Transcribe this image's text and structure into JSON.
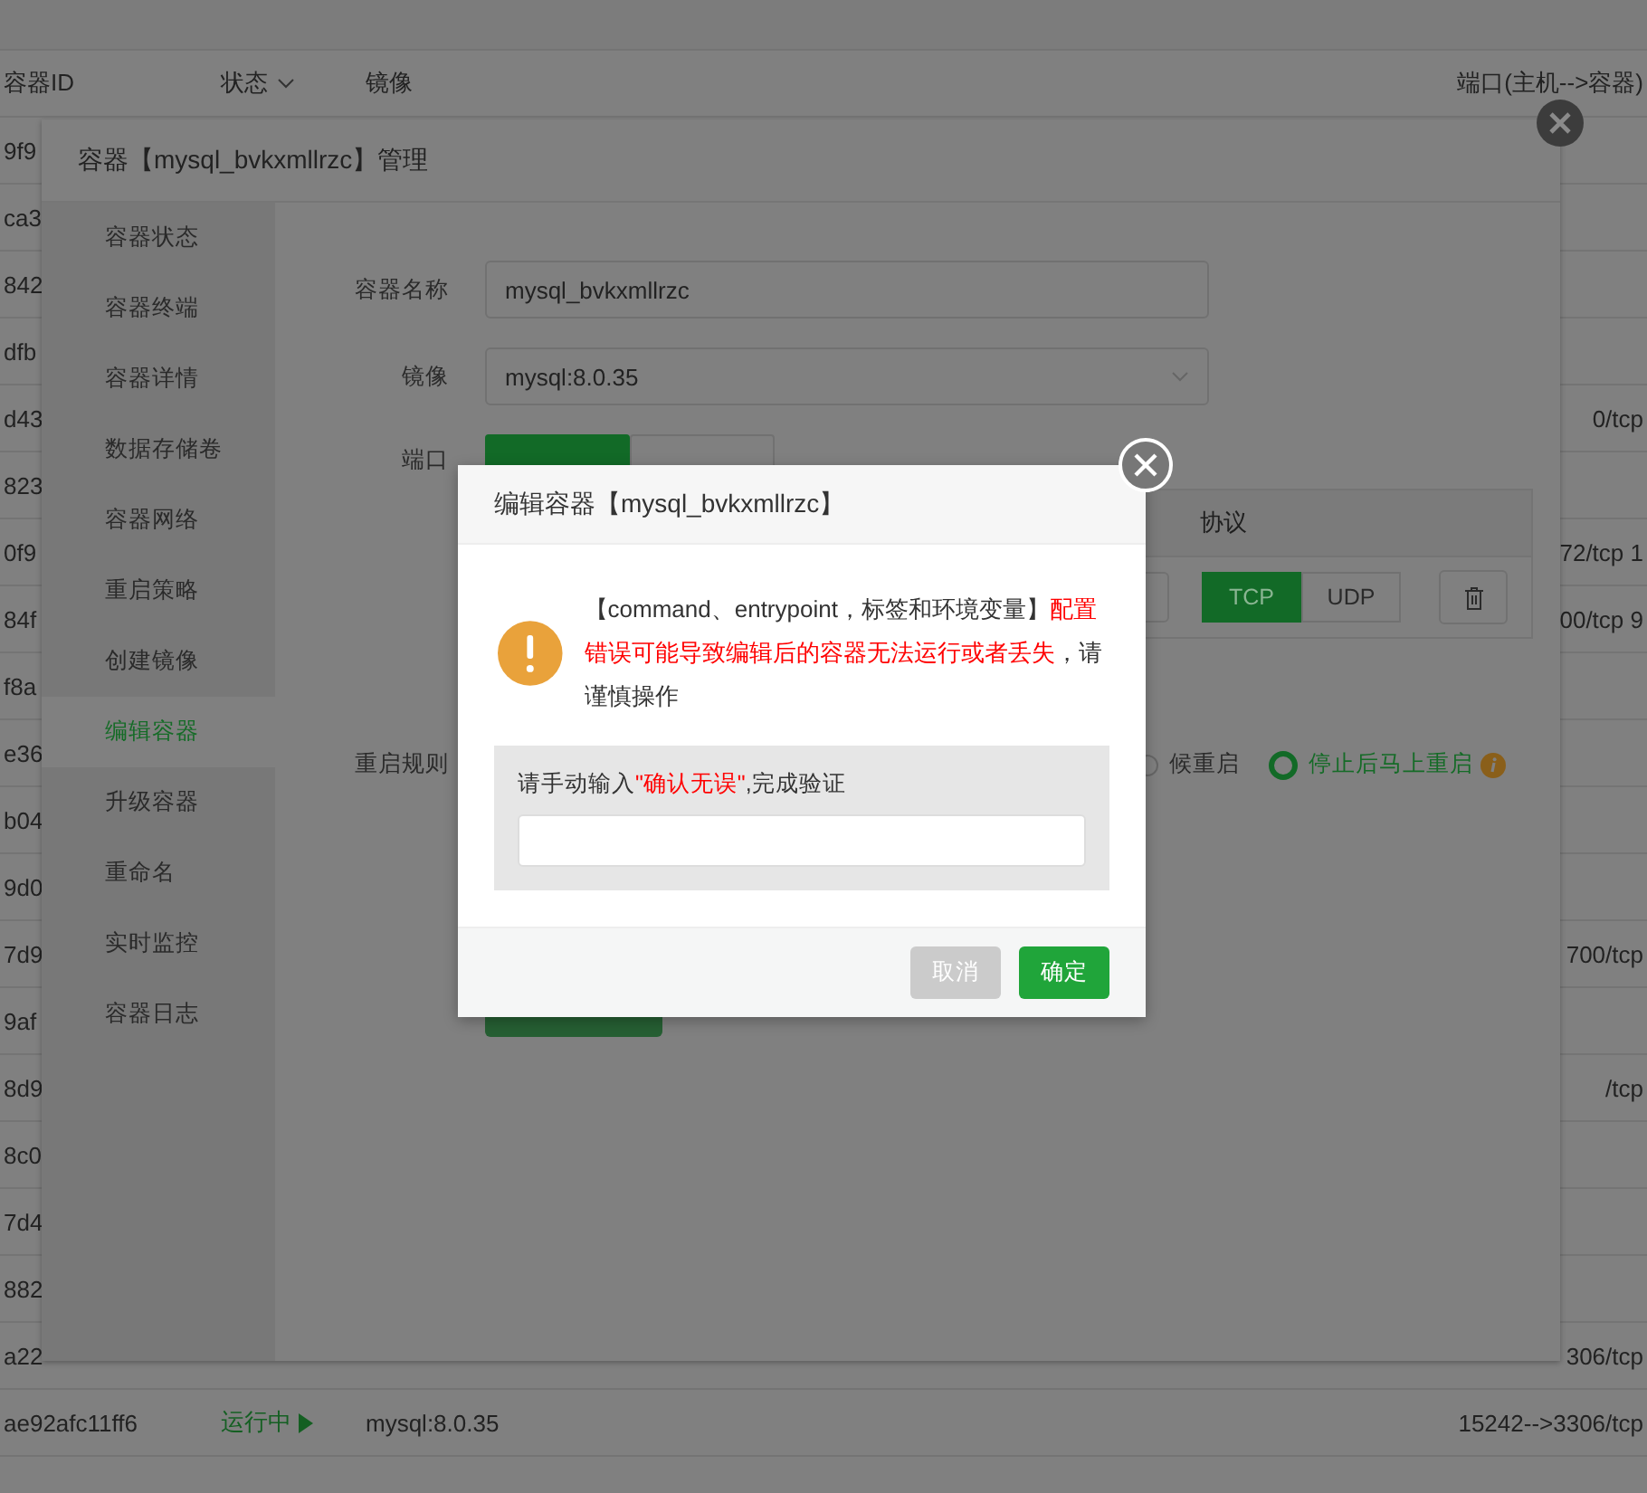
{
  "table": {
    "columns": [
      {
        "label": "容器ID",
        "kind": "plain"
      },
      {
        "label": "状态",
        "kind": "dropdown"
      },
      {
        "label": "镜像",
        "kind": "plain"
      },
      {
        "label": "端口(主机-->容器)",
        "kind": "plain"
      }
    ],
    "rows": [
      {
        "id": "9f9"
      },
      {
        "id": "ca3"
      },
      {
        "id": "842"
      },
      {
        "id": "dfb"
      },
      {
        "id": "d43",
        "ports": "0/tcp"
      },
      {
        "id": "823"
      },
      {
        "id": "0f9",
        "ports": "72/tcp 1"
      },
      {
        "id": "84f",
        "ports": "00/tcp 9"
      },
      {
        "id": "f8a"
      },
      {
        "id": "e36"
      },
      {
        "id": "b04"
      },
      {
        "id": "9d0"
      },
      {
        "id": "7d9",
        "ports": "700/tcp"
      },
      {
        "id": "9af"
      },
      {
        "id": "8d9",
        "ports": "/tcp"
      },
      {
        "id": "8c0"
      },
      {
        "id": "7d4"
      },
      {
        "id": "882"
      },
      {
        "id": "a22",
        "ports": "306/tcp"
      },
      {
        "id": "ae92afc11ff6",
        "status": "运行中",
        "running": true,
        "image": "mysql:8.0.35",
        "ports": "15242-->3306/tcp"
      }
    ]
  },
  "manage_dialog": {
    "title": "容器【mysql_bvkxmllrzc】管理",
    "sidebar": {
      "items": [
        {
          "label": "容器状态",
          "selected": false
        },
        {
          "label": "容器终端",
          "selected": false
        },
        {
          "label": "容器详情",
          "selected": false
        },
        {
          "label": "数据存储卷",
          "selected": false
        },
        {
          "label": "容器网络",
          "selected": false
        },
        {
          "label": "重启策略",
          "selected": false
        },
        {
          "label": "创建镜像",
          "selected": false
        },
        {
          "label": "编辑容器",
          "selected": true
        },
        {
          "label": "升级容器",
          "selected": false
        },
        {
          "label": "重命名",
          "selected": false
        },
        {
          "label": "实时监控",
          "selected": false
        },
        {
          "label": "容器日志",
          "selected": false
        }
      ]
    },
    "form": {
      "name_label": "容器名称",
      "name_value": "mysql_bvkxmllrzc",
      "image_label": "镜像",
      "image_value": "mysql:8.0.35",
      "port_label": "端口",
      "port_modes": [
        {
          "selected": true
        },
        {
          "selected": false
        }
      ],
      "port_table": {
        "protocol_header": "协议",
        "protocols": [
          {
            "label": "TCP",
            "selected": true
          },
          {
            "label": "UDP",
            "selected": false
          }
        ]
      },
      "restart_label": "重启规则",
      "restart_options": [
        {
          "label": "候重启",
          "selected": false
        },
        {
          "label": "停止后马上重启",
          "selected": true
        }
      ]
    }
  },
  "confirm_dialog": {
    "title": "编辑容器【mysql_bvkxmllrzc】",
    "message": [
      {
        "text": "【command、entrypoint，标签和环境变量】",
        "kind": "normal"
      },
      {
        "text": "配置错误可能导致编辑后的容器无法运行或者丢失",
        "kind": "warning"
      },
      {
        "text": "，请谨慎操作",
        "kind": "normal"
      }
    ],
    "verify_label": [
      {
        "text": "请手动输入",
        "kind": "normal"
      },
      {
        "text": "\"确认无误\"",
        "kind": "warning"
      },
      {
        "text": ",完成验证",
        "kind": "normal"
      }
    ],
    "buttons": [
      {
        "label": "取消",
        "kind": "cancel"
      },
      {
        "label": "确定",
        "kind": "confirm"
      }
    ]
  }
}
